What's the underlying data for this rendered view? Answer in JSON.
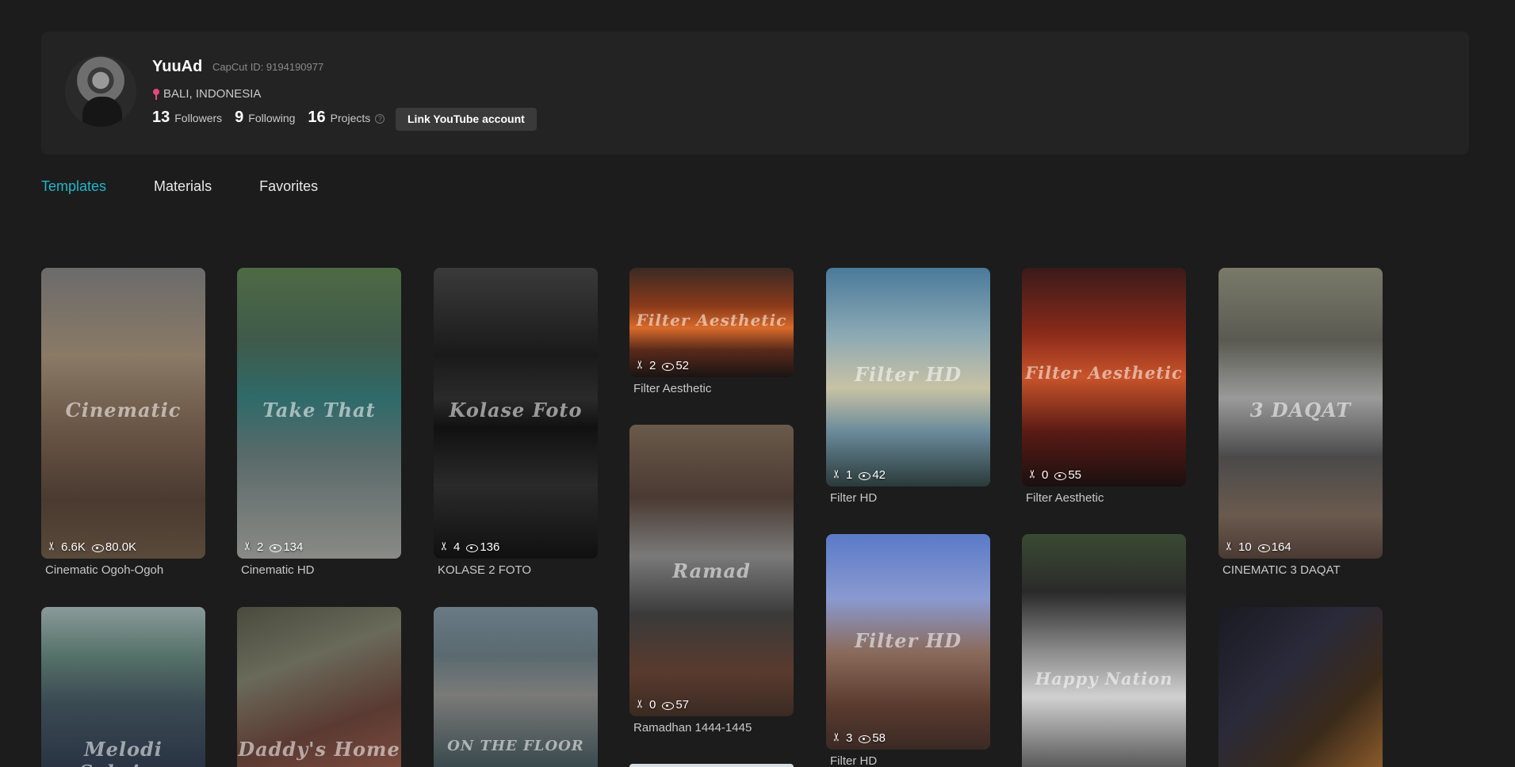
{
  "profile": {
    "username": "YuuAd",
    "capcut_id": "CapCut ID: 9194190977",
    "location": "BALI, INDONESIA",
    "followers_count": "13",
    "followers_label": "Followers",
    "following_count": "9",
    "following_label": "Following",
    "projects_count": "16",
    "projects_label": "Projects",
    "link_youtube_label": "Link YouTube account"
  },
  "tabs": [
    "Templates",
    "Materials",
    "Favorites"
  ],
  "active_tab": "Templates",
  "colors": {
    "accent": "#22b5c9",
    "background": "#1c1c1c",
    "card": "#232323",
    "pin": "#e5487d"
  },
  "templates": [
    {
      "title": "Cinematic Ogoh-Ogoh",
      "watermark": "Cinematic",
      "uses": "6.6K",
      "views": "80.0K"
    },
    {
      "title": "Cinematic HD",
      "watermark": "Take That",
      "uses": "2",
      "views": "134"
    },
    {
      "title": "KOLASE 2 FOTO",
      "watermark": "Kolase Foto",
      "uses": "4",
      "views": "136"
    },
    {
      "title": "Filter Aesthetic",
      "watermark": "Filter Aesthetic",
      "uses": "2",
      "views": "52"
    },
    {
      "title": "Ramadhan 1444-1445",
      "watermark": "Ramad",
      "uses": "0",
      "views": "57"
    },
    {
      "title": "Filter HD",
      "watermark": "Filter HD",
      "uses": "1",
      "views": "42"
    },
    {
      "title": "Filter HD",
      "watermark": "Filter HD",
      "uses": "3",
      "views": "58"
    },
    {
      "title": "Filter Aesthetic",
      "watermark": "Filter Aesthetic",
      "uses": "0",
      "views": "55"
    },
    {
      "title": "",
      "watermark": "Happy Nation",
      "uses": "",
      "views": ""
    },
    {
      "title": "CINEMATIC 3 DAQAT",
      "watermark": "3 DAQAT",
      "uses": "10",
      "views": "164"
    },
    {
      "title": "",
      "watermark": "",
      "uses": "",
      "views": ""
    },
    {
      "title": "",
      "watermark": "Melodi Sabrina",
      "uses": "",
      "views": ""
    },
    {
      "title": "",
      "watermark": "Daddy's Home",
      "uses": "",
      "views": ""
    },
    {
      "title": "",
      "watermark": "ON THE FLOOR",
      "uses": "",
      "views": ""
    }
  ]
}
